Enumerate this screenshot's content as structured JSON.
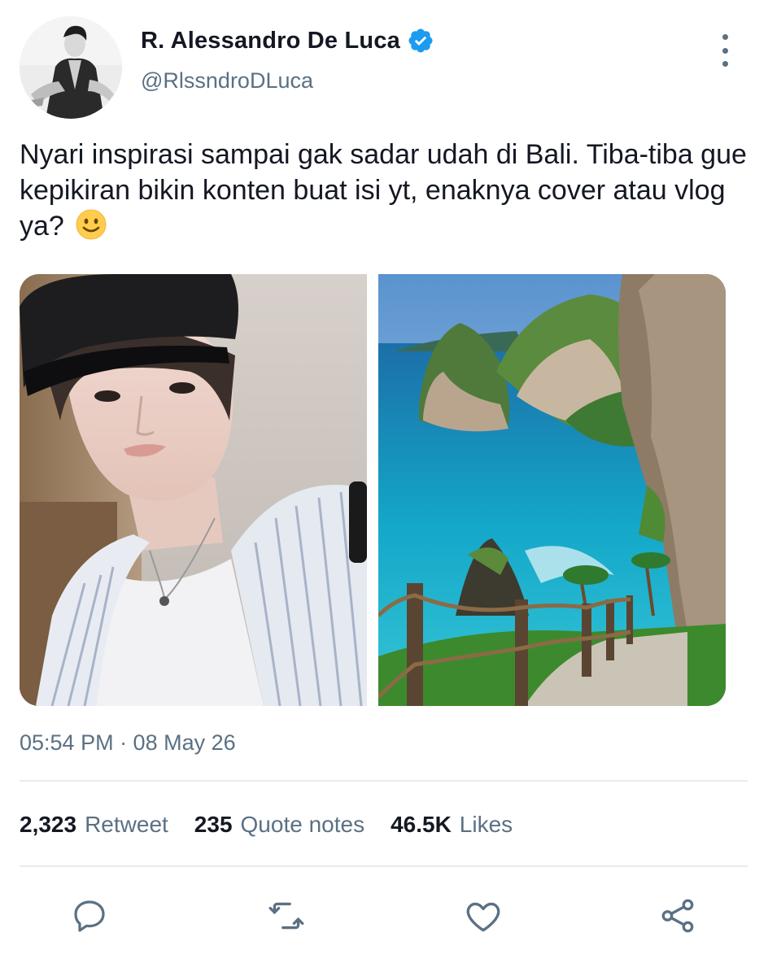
{
  "author": {
    "display_name": "R. Alessandro De Luca",
    "handle": "@RlssndroDLuca",
    "verified": true
  },
  "tweet": {
    "text": "Nyari inspirasi sampai gak sadar udah di Bali. Tiba-tiba gue kepikiran bikin konten buat isi yt, enaknya cover atau vlog ya?",
    "emoji": "🙂",
    "timestamp": "05:54 PM · 08 May 26"
  },
  "media": [
    {
      "icon": "selfie-photo"
    },
    {
      "icon": "bali-cliff-photo"
    }
  ],
  "stats": {
    "retweets": {
      "count": "2,323",
      "label": "Retweet"
    },
    "quotes": {
      "count": "235",
      "label": "Quote notes"
    },
    "likes": {
      "count": "46.5K",
      "label": "Likes"
    }
  },
  "actions": [
    "reply-icon",
    "retweet-icon",
    "like-icon",
    "share-icon"
  ],
  "colors": {
    "text": "#141823",
    "secondary": "#5b7083",
    "verified": "#1d9bf0",
    "divider": "#e6ecf0"
  }
}
